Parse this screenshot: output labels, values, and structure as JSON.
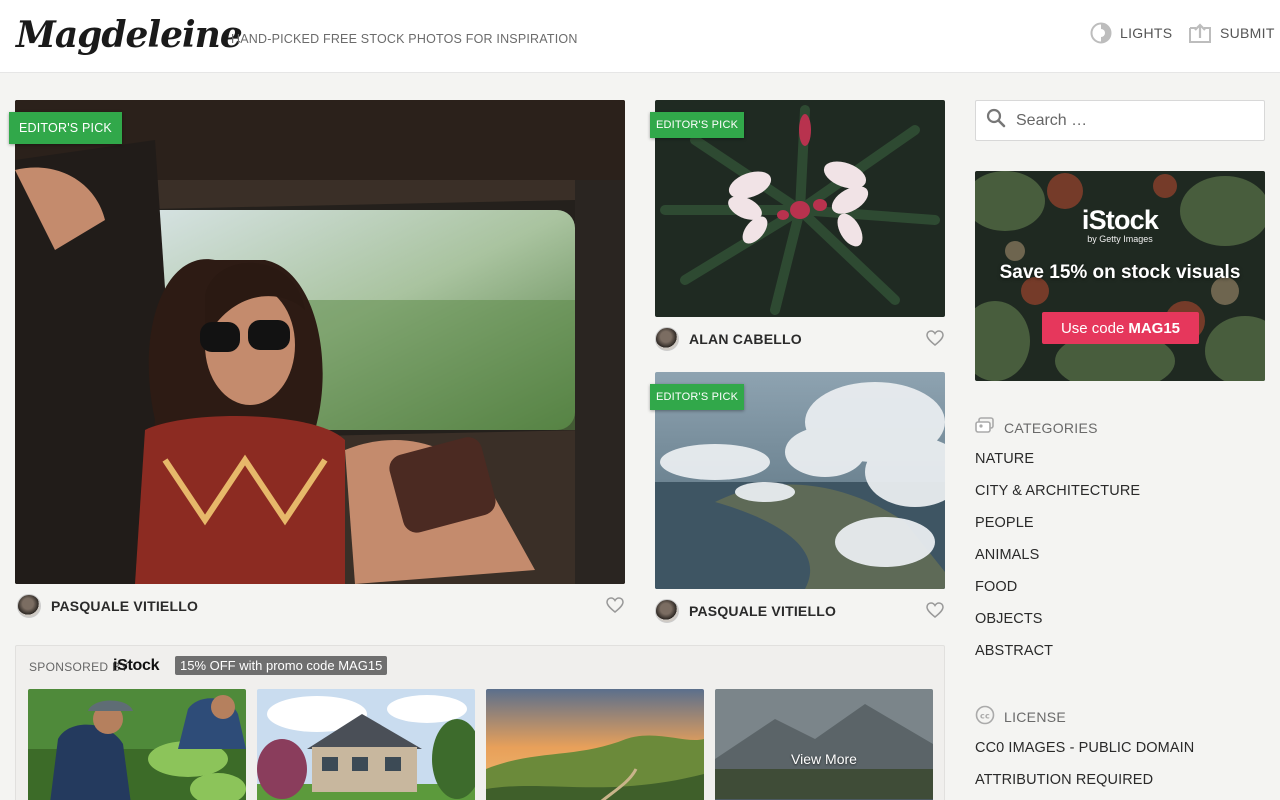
{
  "header": {
    "logo": "Magdeleine",
    "tagline": "HAND-PICKED FREE STOCK PHOTOS FOR INSPIRATION",
    "lights_label": "LIGHTS",
    "submit_label": "SUBMIT"
  },
  "photos": [
    {
      "badge": "EDITOR'S PICK",
      "author": "PASQUALE VITIELLO"
    },
    {
      "badge": "EDITOR'S PICK",
      "author": "ALAN CABELLO"
    },
    {
      "badge": "EDITOR'S PICK",
      "author": "PASQUALE VITIELLO"
    }
  ],
  "sponsored": {
    "label": "SPONSORED BY",
    "brand": "iStock",
    "promo": "15% OFF with promo code MAG15",
    "view_more": "View More"
  },
  "sidebar": {
    "search_placeholder": "Search …",
    "ad": {
      "logo": "iStock",
      "logo_sub": "by Getty Images",
      "headline": "Save 15% on stock visuals",
      "button_text": "Use code",
      "button_code": "MAG15"
    },
    "categories_title": "CATEGORIES",
    "categories": [
      "NATURE",
      "CITY & ARCHITECTURE",
      "PEOPLE",
      "ANIMALS",
      "FOOD",
      "OBJECTS",
      "ABSTRACT"
    ],
    "license_title": "LICENSE",
    "licenses": [
      "CC0 IMAGES - PUBLIC DOMAIN",
      "ATTRIBUTION REQUIRED"
    ]
  },
  "colors": {
    "badge_green": "#31a84a",
    "ad_button": "#e6375c",
    "promo_grey": "#6f6f6f"
  }
}
